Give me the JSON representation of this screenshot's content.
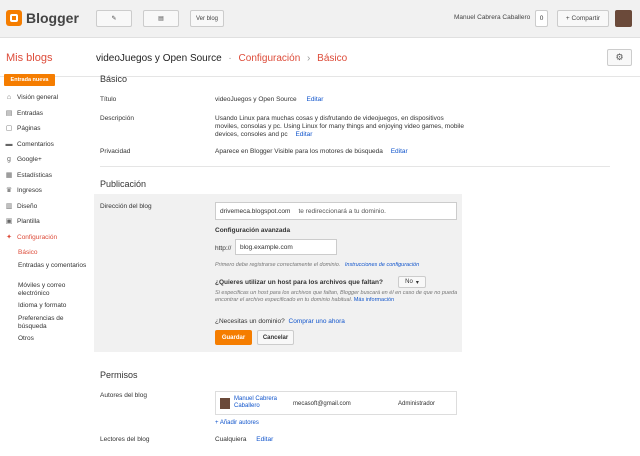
{
  "topbar": {
    "logo_text": "Blogger",
    "view_blog": "Ver blog",
    "user_name": "Manuel Cabrera Caballero",
    "count": "0",
    "share": "+ Compartir"
  },
  "header": {
    "my_blogs": "Mis blogs",
    "blog_name": "videoJuegos y Open Source",
    "section": "Configuración",
    "subsection": "Básico",
    "separator": "›"
  },
  "sidebar": {
    "new_entry": "Entrada nueva",
    "items": [
      {
        "label": "Visión general",
        "icon": "home-icon"
      },
      {
        "label": "Entradas",
        "icon": "posts-icon"
      },
      {
        "label": "Páginas",
        "icon": "pages-icon"
      },
      {
        "label": "Comentarios",
        "icon": "comments-icon"
      },
      {
        "label": "Google+",
        "icon": "google-plus-icon"
      },
      {
        "label": "Estadísticas",
        "icon": "stats-icon"
      },
      {
        "label": "Ingresos",
        "icon": "trophy-icon"
      },
      {
        "label": "Diseño",
        "icon": "layout-icon"
      },
      {
        "label": "Plantilla",
        "icon": "template-icon"
      },
      {
        "label": "Configuración",
        "icon": "wrench-icon"
      }
    ],
    "sub_items": [
      "Básico",
      "Entradas y comentarios",
      "Móviles y correo electrónico",
      "Idioma y formato",
      "Preferencias de búsqueda",
      "Otros"
    ]
  },
  "basic": {
    "title": "Básico",
    "title_label": "Título",
    "title_value": "videoJuegos y Open Source",
    "desc_label": "Descripción",
    "desc_value": "Usando Linux para muchas cosas y disfrutando de videojuegos, en dispositivos moviles, consolas y pc. Using Linux for many things and enjoying video games, mobile devices, consoles and pc",
    "privacy_label": "Privacidad",
    "privacy_value": "Aparece en Blogger Visible para los motores de búsqueda",
    "edit": "Editar"
  },
  "publication": {
    "title": "Publicación",
    "address_label": "Dirección del blog",
    "address_value": "drivemeca.blogspot.com",
    "redirect_text": "te redireccionará a tu dominio.",
    "advanced_title": "Configuración avanzada",
    "protocol": "http://",
    "domain_placeholder": "blog.example.com",
    "register_note": "Primero debe registrarse correctamente el dominio.",
    "setup_link": "Instrucciones de configuración",
    "missing_host_q": "¿Quieres utilizar un host para los archivos que faltan?",
    "missing_host_value": "No",
    "missing_host_note": "Si especificas un host para los archivos que faltan, Blogger buscará en él en caso de que no pueda encontrar el archivo especificado en tu dominio habitual.",
    "more_info": "Más información",
    "need_domain": "¿Necesitas un dominio?",
    "buy_link": "Comprar uno ahora",
    "save": "Guardar",
    "cancel": "Cancelar"
  },
  "permissions": {
    "title": "Permisos",
    "authors_label": "Autores del blog",
    "author_name": "Manuel Cabrera Caballero",
    "author_email": "mecasoft@gmail.com",
    "author_role": "Administrador",
    "add_authors": "+ Añadir autores",
    "readers_label": "Lectores del blog",
    "readers_value": "Cualquiera",
    "edit": "Editar"
  }
}
